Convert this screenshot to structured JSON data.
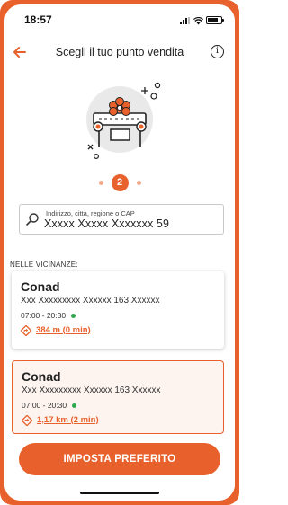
{
  "status_bar": {
    "time": "18:57"
  },
  "header": {
    "title": "Scegli il tuo punto vendita",
    "info_symbol": "i"
  },
  "stepper": {
    "current_step": "2"
  },
  "search": {
    "label": "Indirizzo, città, regione o CAP",
    "value": "Xxxxx Xxxxx Xxxxxxx 59"
  },
  "nearby": {
    "section_label": "NELLE VICINANZE:",
    "stores": [
      {
        "name": "Conad",
        "address": "Xxx Xxxxxxxxx Xxxxxx 163 Xxxxxx",
        "hours": "07:00 - 20:30",
        "distance": "384 m (0 min)"
      },
      {
        "name": "Conad",
        "address": "Xxx Xxxxxxxxx Xxxxxx 163 Xxxxxx",
        "hours": "07:00 - 20:30",
        "distance": "1,17 km (2 min)"
      }
    ]
  },
  "cta": {
    "label": "IMPOSTA PREFERITO"
  },
  "colors": {
    "accent": "#e8612c",
    "open_status": "#2fa84f",
    "selected_bg": "#fdf3ef"
  },
  "icons": [
    "back-arrow-icon",
    "info-icon",
    "store-illustration-icon",
    "search-icon",
    "directions-icon",
    "signal-icon",
    "wifi-icon",
    "battery-icon"
  ]
}
